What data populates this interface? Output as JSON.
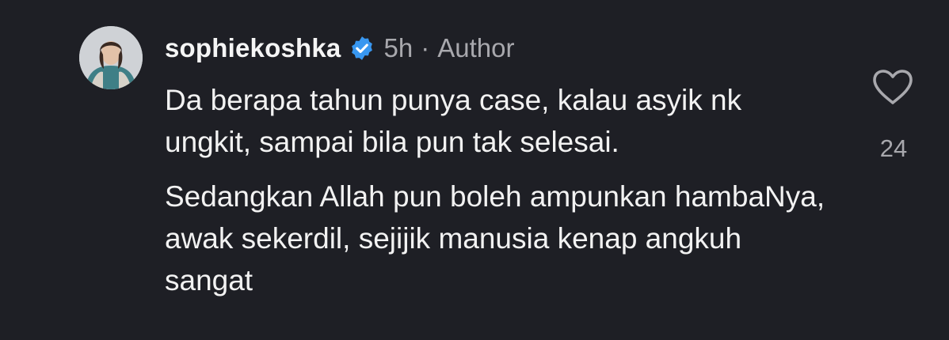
{
  "comment": {
    "username": "sophiekoshka",
    "time": "5h",
    "separator": "·",
    "role": "Author",
    "paragraphs": [
      "Da berapa tahun punya case, kalau asyik nk ungkit, sampai bila pun tak selesai.",
      "Sedangkan Allah pun boleh ampunkan hambaNya, awak sekerdil, sejijik manusia kenap angkuh sangat"
    ],
    "like_count": "24"
  },
  "icons": {
    "avatar": "profile-photo",
    "verified": "verified-badge-icon",
    "like": "heart-outline-icon"
  },
  "colors": {
    "background": "#1e1f25",
    "text": "#f2f2f2",
    "muted": "#a8a8ad",
    "verified": "#3897f0"
  }
}
